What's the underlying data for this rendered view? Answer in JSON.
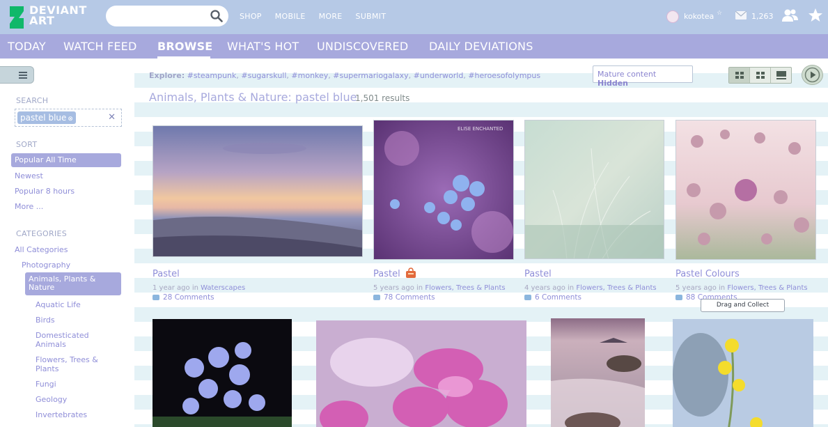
{
  "brand": {
    "name_line1": "DEVIANT",
    "name_line2": "ART",
    "color": "#10b86a"
  },
  "topbar": {
    "search_placeholder": "",
    "nav": [
      "SHOP",
      "MOBILE",
      "MORE",
      "SUBMIT"
    ],
    "username": "kokotea",
    "username_symbol": "☆",
    "message_count": "1,263"
  },
  "tabs": [
    {
      "label": "TODAY",
      "active": false
    },
    {
      "label": "WATCH FEED",
      "active": false
    },
    {
      "label": "BROWSE",
      "active": true
    },
    {
      "label": "WHAT'S HOT",
      "active": false
    },
    {
      "label": "UNDISCOVERED",
      "active": false
    },
    {
      "label": "DAILY DEVIATIONS",
      "active": false
    }
  ],
  "sidebar": {
    "search_heading": "SEARCH",
    "search_tag": "pastel blue",
    "search_tag_close": "⊗",
    "clear_symbol": "✕",
    "sort_heading": "SORT",
    "sort_options": [
      "Popular All Time",
      "Newest",
      "Popular 8 hours",
      "More ..."
    ],
    "categories_heading": "CATEGORIES",
    "categories_root": "All Categories",
    "categories_parent": "Photography",
    "categories_active": "Animals, Plants & Nature",
    "subcategories": [
      "Aquatic Life",
      "Birds",
      "Domesticated Animals",
      "Flowers, Trees & Plants",
      "Fungi",
      "Geology",
      "Invertebrates"
    ]
  },
  "explore": {
    "label": "Explore:",
    "tags": [
      "#steampunk",
      "#sugarskull",
      "#monkey",
      "#supermariogalaxy",
      "#underworld",
      "#heroesofolympus"
    ]
  },
  "mature": {
    "label": "Mature content",
    "state": "Hidden"
  },
  "heading": {
    "title": "Animals, Plants & Nature: pastel blue",
    "results": "1,501 results"
  },
  "watermark": "ELISE ENCHANTED",
  "deviations": [
    {
      "title": "Pastel",
      "age": "1 year ago",
      "in": "in",
      "category": "Waterscapes",
      "comments": "28 Comments"
    },
    {
      "title": "Pastel",
      "age": "5 years ago",
      "in": "in",
      "category": "Flowers, Trees & Plants",
      "comments": "78 Comments"
    },
    {
      "title": "Pastel",
      "age": "4 years ago",
      "in": "in",
      "category": "Flowers, Trees & Plants",
      "comments": "6 Comments"
    },
    {
      "title": "Pastel Colours",
      "age": "5 years ago",
      "in": "in",
      "category": "Flowers, Trees & Plants",
      "comments": "88 Comments"
    }
  ],
  "tooltip": "Drag and Collect"
}
